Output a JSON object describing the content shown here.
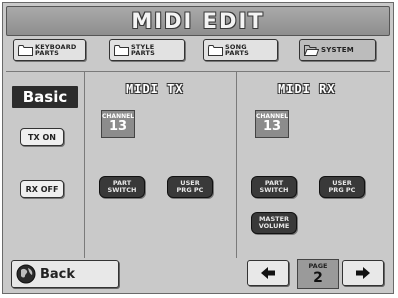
{
  "title": "MIDI EDIT",
  "tabs": [
    {
      "label": "KEYBOARD\nPARTS",
      "selected": false
    },
    {
      "label": "STYLE\nPARTS",
      "selected": false
    },
    {
      "label": "SONG\nPARTS",
      "selected": false
    },
    {
      "label": "SYSTEM",
      "selected": true
    }
  ],
  "sidebar": {
    "section_label": "Basic",
    "tx_button": "TX ON",
    "rx_button": "RX OFF"
  },
  "midi_tx": {
    "heading": "MIDI TX",
    "channel_label": "CHANNEL",
    "channel_value": "13",
    "part_switch": "PART\nSWITCH",
    "user_prg_pc": "USER\nPRG PC"
  },
  "midi_rx": {
    "heading": "MIDI RX",
    "channel_label": "CHANNEL",
    "channel_value": "13",
    "part_switch": "PART\nSWITCH",
    "user_prg_pc": "USER\nPRG PC",
    "master_volume": "MASTER\nVOLUME"
  },
  "footer": {
    "back_label": "Back",
    "page_label": "PAGE",
    "page_value": "2",
    "prev_icon": "left-arrow-icon",
    "next_icon": "right-arrow-icon"
  },
  "colors": {
    "background": "#c9c9c9",
    "title_bar": "#9a9a9a",
    "dark_button": "#393939",
    "channel_box": "#8c8c8c"
  }
}
